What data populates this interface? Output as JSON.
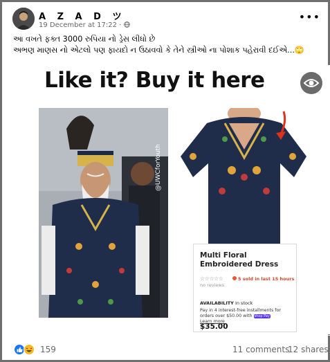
{
  "post": {
    "author": "A Z A D ツ",
    "timestamp": "19 December at 17:22",
    "audience_icon": "globe-icon",
    "more_icon": "more-options-icon",
    "caption_line_1": "આ વખતે ફક્ત 3000 રુપિયા નો ડ્રેસ લીધો છે",
    "caption_line_2": "અભણ માણસ નો એટલો પણ ફાયદો ન ઉઠાવવો કે તેને સ્ત્રીઓ ના પોશાક પહેરાવી દઈએ...🙄"
  },
  "media": {
    "headline": "Like it? Buy it here",
    "watermark": "@UWCforYouth",
    "eye_icon": "eye-icon",
    "product_card": {
      "title": "Multi Floral Embroidered Dress",
      "rating_stars": "☆☆☆☆☆",
      "rating_label": "no reviews",
      "sold_text": "5 sold in last 15 hours",
      "availability_label": "AVAILABILITY",
      "availability_value": "In stock",
      "installments_text": "Pay in 4 interest-free installments for orders over $50.00 with",
      "shop_pay": "shop Pay",
      "learn_more": "Learn more",
      "price": "$35.00"
    }
  },
  "footer": {
    "reaction_icons": [
      "like-icon",
      "haha-icon"
    ],
    "reaction_count": "159",
    "comments": "11 comments",
    "shares": "12 shares"
  },
  "colors": {
    "secondary_text": "#65676b",
    "like_blue": "#1877f2",
    "haha_yellow": "#f7b928",
    "arrow_red": "#e0301e",
    "dress_navy": "#1f2d4a"
  }
}
